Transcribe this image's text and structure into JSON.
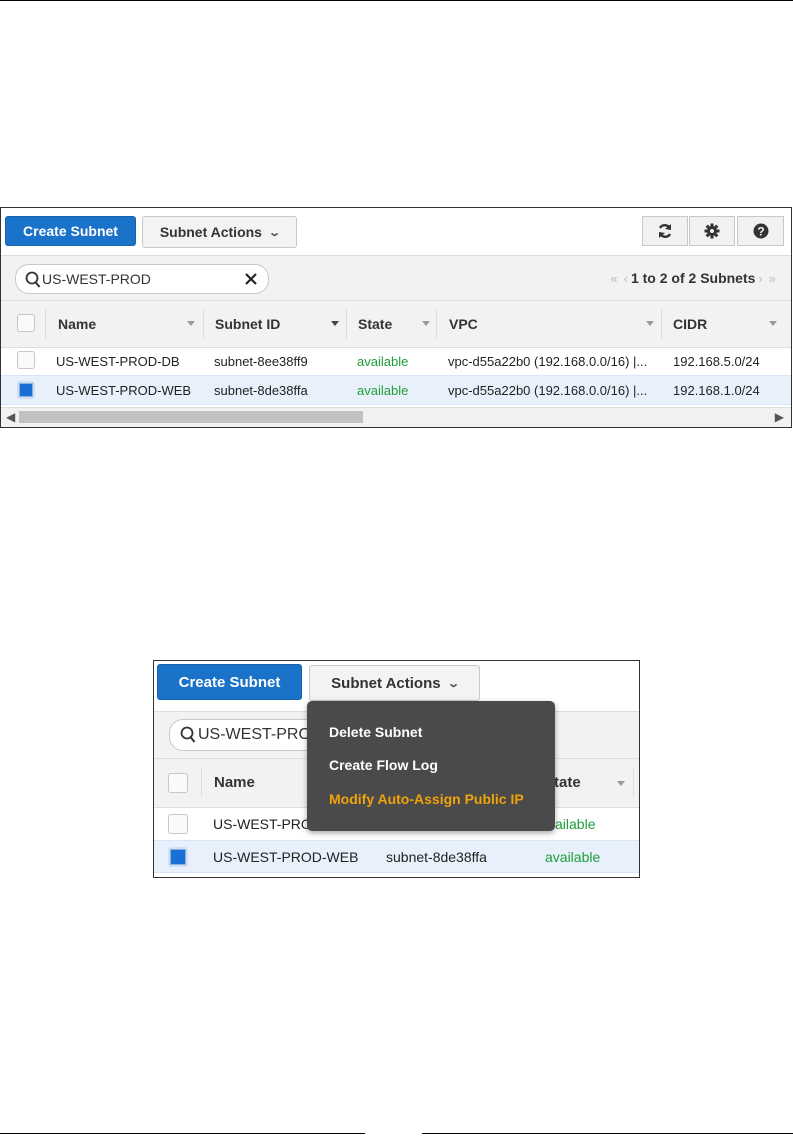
{
  "toolbar": {
    "create_label": "Create Subnet",
    "actions_label": "Subnet Actions",
    "refresh_icon": "refresh-icon",
    "settings_icon": "gear-icon",
    "help_icon": "help-icon"
  },
  "search": {
    "value": "US-WEST-PROD",
    "pagination": "1 to 2 of 2 Subnets"
  },
  "table": {
    "columns": [
      "Name",
      "Subnet ID",
      "State",
      "VPC",
      "CIDR"
    ],
    "rows": [
      {
        "name": "US-WEST-PROD-DB",
        "subnet_id": "subnet-8ee38ff9",
        "state": "available",
        "vpc": "vpc-d55a22b0 (192.168.0.0/16) |...",
        "cidr": "192.168.5.0/24",
        "selected": false
      },
      {
        "name": "US-WEST-PROD-WEB",
        "subnet_id": "subnet-8de38ffa",
        "state": "available",
        "vpc": "vpc-d55a22b0 (192.168.0.0/16) |...",
        "cidr": "192.168.1.0/24",
        "selected": true
      }
    ]
  },
  "detail": {
    "create_label": "Create Subnet",
    "actions_label": "Subnet Actions",
    "search_value": "US-WEST-PROD",
    "col_name": "Name",
    "col_state_partial": "tate",
    "row1_name_partial": "US-WEST-PRO",
    "row1_state_partial": "vailable",
    "row2_name": "US-WEST-PROD-WEB",
    "row2_subnet": "subnet-8de38ffa",
    "row2_state": "available",
    "menu": [
      "Delete Subnet",
      "Create Flow Log",
      "Modify Auto-Assign Public IP"
    ],
    "menu_highlight_color": "#f0a30a"
  },
  "colors": {
    "primary": "#1a73c9",
    "available": "#1f9d3a",
    "selected_row": "#e8f1fb"
  }
}
